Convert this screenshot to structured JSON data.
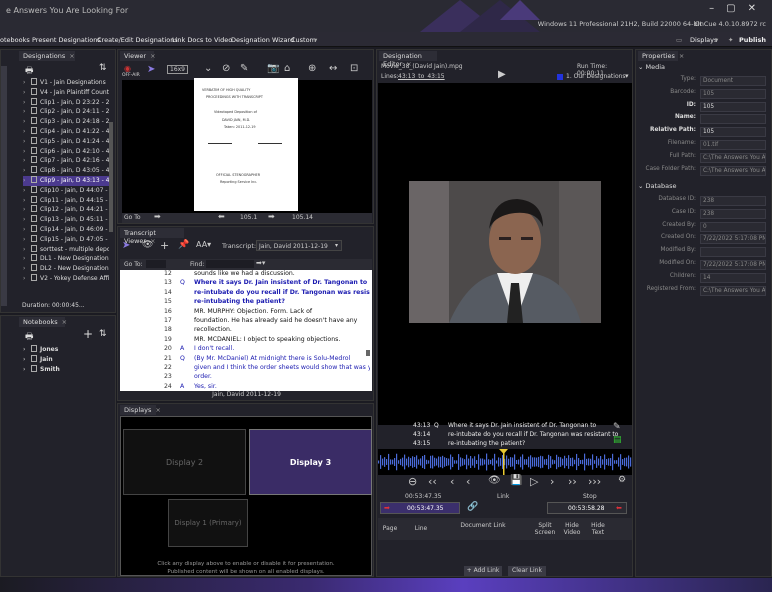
{
  "title": "e Answers You Are Looking For",
  "sysinfo": "Windows 11 Professional 21H2, Build 22000 64-bit",
  "version": "OnCue 4.0.10.8972 rc",
  "menu": {
    "notebooks": "otebooks",
    "present": "Present Designations",
    "create": "Create/Edit Designations",
    "link": "Link Docs to Video",
    "wizard": "Designation Wizard",
    "custom": "Custom",
    "displays": "Displays",
    "publish": "Publish"
  },
  "designations": {
    "tab": "Designations",
    "items": [
      "V1 - Jain Designations",
      "V4 - Jain Plaintiff Counter",
      "Clip1 - Jain, D 23:22 - 24:0",
      "Clip2 - Jain, D 24:11 - 24:1",
      "Clip3 - Jain, D 24:18 - 24:2",
      "Clip4 - Jain, D 41:22 - 41:2",
      "Clip5 - Jain, D 41:24 - 42:0",
      "Clip6 - Jain, D 42:10 - 42:1",
      "Clip7 - Jain, D 42:16 - 42:2",
      "Clip8 - Jain, D 43:05 - 43:1",
      "Clip9 - Jain, D 43:13 - 44:0",
      "Clip10 - Jain, D 44:07 - 44:",
      "Clip11 - Jain, D 44:15 - 44:",
      "Clip12 - Jain, D 44:21 - 44:",
      "Clip13 - Jain, D 45:11 - 45:",
      "Clip14 - Jain, D 46:09 - 46:",
      "Clip15 - Jain, D 47:05 - 48:",
      "sorttest - multiple depone",
      "DL1 - New Designation Lis",
      "DL2 - New Designation Lis",
      "V2 - Yokey Defense Affirm"
    ],
    "duration": "Duration: 00:00:45..."
  },
  "notebooks": {
    "tab": "Notebooks",
    "items": [
      "Jones",
      "Jain",
      "Smith"
    ]
  },
  "viewer": {
    "tab": "Viewer",
    "offair": "OFF-AIR",
    "ratio": "16x9",
    "goto": "Go To",
    "page": "105.1",
    "page2": "105.14",
    "doc_lines": [
      "VERBATIM OF HIGH QUALITY",
      "PROCEEDINGS WITH TRANSCRIPT",
      "Videotaped Deposition of",
      "DAVID JAIN, M.D.",
      "Taken: 2011-12-19",
      "OFFICIAL STENOGRAPHER",
      "Reporting Service Inc."
    ]
  },
  "transcript": {
    "tab": "Transcript Viewer",
    "label": "Transcript:",
    "value": "Jain, David 2011-12-19",
    "goto": "Go To:",
    "find": "Find:",
    "footer": "Jain, David 2011-12-19",
    "lines": [
      {
        "n": "12",
        "qa": "",
        "t": "sounds like we had a discussion.",
        "c": "#111"
      },
      {
        "n": "13",
        "qa": "Q",
        "t": "Where it says Dr. Jain insistent of Dr. Tangonan to",
        "c": "#1a1ab0",
        "b": true
      },
      {
        "n": "14",
        "qa": "",
        "t": "re-intubate do you recall if Dr. Tangonan was resistant to",
        "c": "#1a1ab0",
        "b": true
      },
      {
        "n": "15",
        "qa": "",
        "t": "re-intubating the patient?",
        "c": "#1a1ab0",
        "b": true
      },
      {
        "n": "16",
        "qa": "",
        "t": "MR. MURPHY:  Objection.  Form.  Lack of",
        "c": "#111"
      },
      {
        "n": "17",
        "qa": "",
        "t": "foundation.  He has already said he doesn't have any",
        "c": "#111"
      },
      {
        "n": "18",
        "qa": "",
        "t": "recollection.",
        "c": "#111"
      },
      {
        "n": "19",
        "qa": "",
        "t": "MR. MCDANIEL:  I object to speaking objections.",
        "c": "#111"
      },
      {
        "n": "20",
        "qa": "A",
        "t": "I don't recall.",
        "c": "#1a1ab0"
      },
      {
        "n": "21",
        "qa": "Q",
        "t": "(By Mr. McDaniel)  At midnight there is Solu-Medrol",
        "c": "#1a1ab0"
      },
      {
        "n": "22",
        "qa": "",
        "t": "given and I think the order sheets would show that was your",
        "c": "#1a1ab0"
      },
      {
        "n": "23",
        "qa": "",
        "t": "order.",
        "c": "#1a1ab0"
      },
      {
        "n": "24",
        "qa": "A",
        "t": "Yes, sir.",
        "c": "#1a1ab0"
      }
    ]
  },
  "displays": {
    "tab": "Displays",
    "d2": "Display 2",
    "d3": "Display 3",
    "d1": "Display 1 (Primary)",
    "help1": "Click any display above to enable or disable it for presentation.",
    "help2": "Published content will be shown on all enabled displays."
  },
  "editor": {
    "tab": "Designation Editor",
    "file": "Movie_38_(David Jain).mpg",
    "runtime": "Run Time: 00:00:11",
    "lines_label": "Lines:",
    "lines_value": "43:13_to_43:15",
    "designations": "1. Our Designations",
    "sub": [
      {
        "n": "43:13",
        "qa": "Q",
        "t": "Where it says Dr. Jain insistent of Dr. Tangonan to"
      },
      {
        "n": "43:14",
        "qa": "",
        "t": "re-intubate do you recall if Dr. Tangonan was resistant to"
      },
      {
        "n": "43:15",
        "qa": "",
        "t": "re-intubating the patient?"
      }
    ],
    "time_start": "00:53:47.35",
    "link": "Link",
    "stop": "Stop",
    "in_time": "00:53:47.35",
    "out_time": "00:53:58.28",
    "cols": [
      "Page",
      "Line",
      "Document Link",
      "Split Screen",
      "Hide Video",
      "Hide Text"
    ],
    "add": "Add Link",
    "clear": "Clear Link"
  },
  "properties": {
    "tab": "Properties",
    "media": "Media",
    "database": "Database",
    "media_rows": [
      {
        "k": "Type:",
        "v": "Document",
        "b": false
      },
      {
        "k": "Barcode:",
        "v": "105",
        "b": false
      },
      {
        "k": "ID:",
        "v": "105",
        "b": true
      },
      {
        "k": "Name:",
        "v": "",
        "b": true
      },
      {
        "k": "Relative Path:",
        "v": "105",
        "b": true
      },
      {
        "k": "Filename:",
        "v": "01.tif",
        "b": false
      },
      {
        "k": "Full Path:",
        "v": "C:\\The Answers You Are",
        "b": false
      },
      {
        "k": "Case Folder Path:",
        "v": "C:\\The Answers You Are",
        "b": false
      }
    ],
    "db_rows": [
      {
        "k": "Database ID:",
        "v": "238"
      },
      {
        "k": "Case ID:",
        "v": "238"
      },
      {
        "k": "Created By:",
        "v": "0"
      },
      {
        "k": "Created On:",
        "v": "7/22/2022 5:17:08 PM"
      },
      {
        "k": "Modified By:",
        "v": ""
      },
      {
        "k": "Modified On:",
        "v": "7/22/2022 5:17:08 PM"
      },
      {
        "k": "Children:",
        "v": "14"
      },
      {
        "k": "Registered From:",
        "v": "C:\\The Answers You Are"
      }
    ]
  },
  "colors": {
    "accent": "#5a3fbf",
    "selected": "#4b3a8f",
    "red": "#e0303a",
    "bg": "#1b1b22"
  }
}
